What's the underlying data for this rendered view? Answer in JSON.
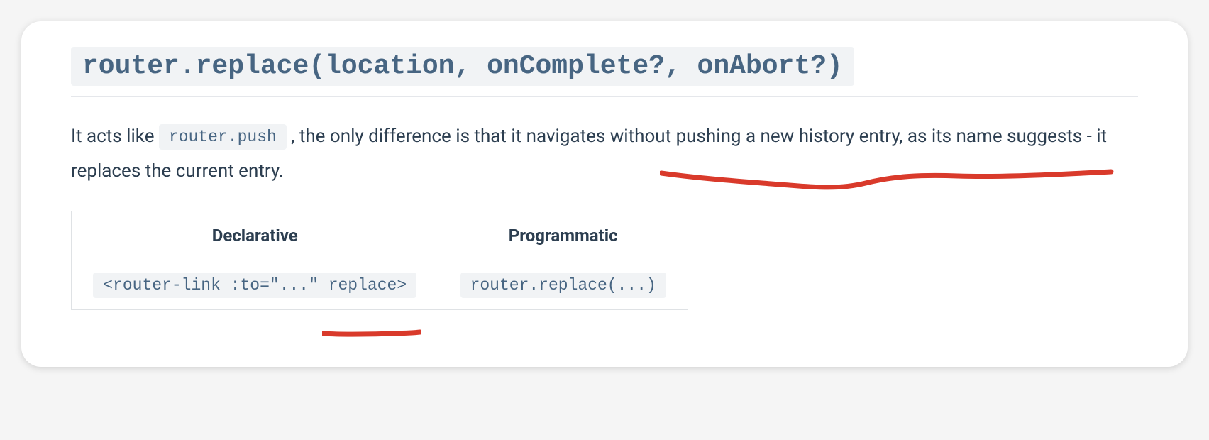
{
  "heading": "router.replace(location, onComplete?, onAbort?)",
  "paragraph": {
    "before_code": "It acts like ",
    "code": "router.push",
    "after_code": ", the only difference is that it navigates without pushing a new history entry, as its name suggests - it replaces the current entry."
  },
  "table": {
    "headers": [
      "Declarative",
      "Programmatic"
    ],
    "row": {
      "declarative_code": "<router-link :to=\"...\" replace>",
      "programmatic_code": "router.replace(...)"
    }
  }
}
